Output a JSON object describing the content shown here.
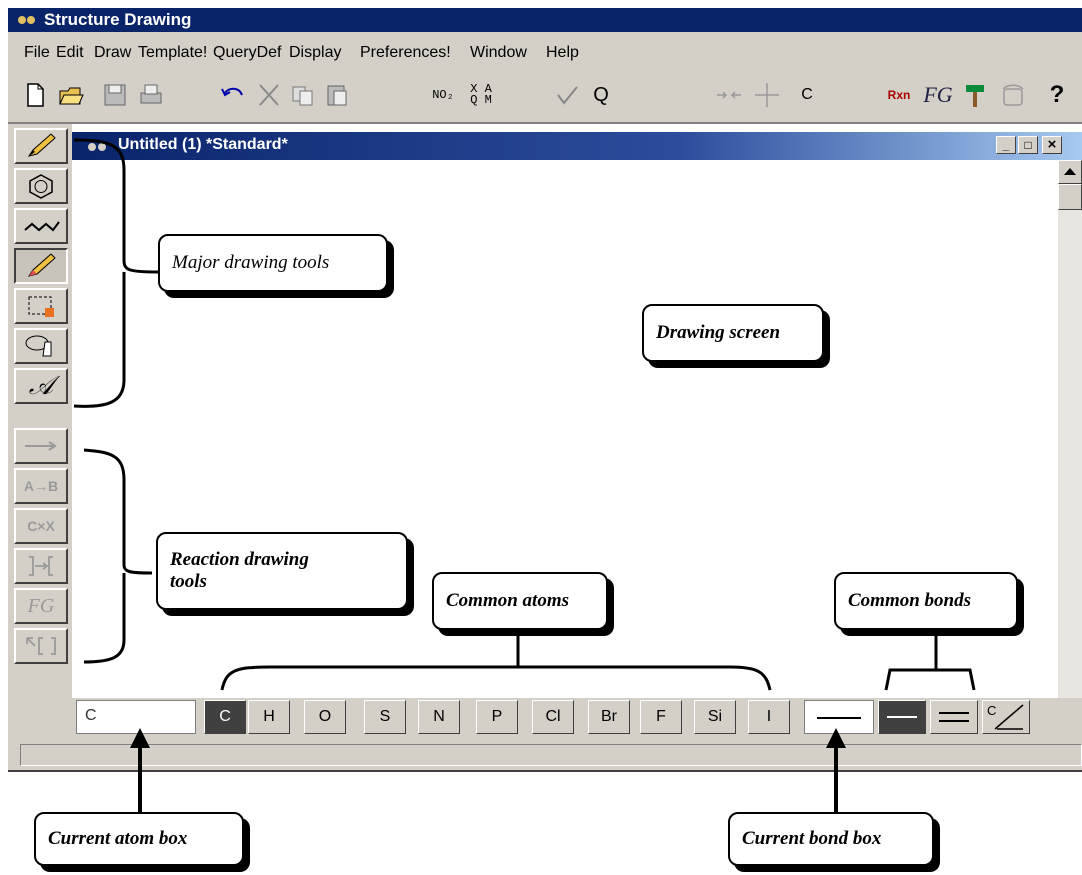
{
  "app": {
    "title": "Structure Drawing",
    "menu": [
      "File",
      "Edit",
      "Draw",
      "Template!",
      "QueryDef",
      "Display",
      "Preferences!",
      "Window",
      "Help"
    ]
  },
  "toolbar": {
    "buttons": [
      {
        "icon": "new-document-icon"
      },
      {
        "icon": "open-folder-icon"
      },
      {
        "icon": "save-icon"
      },
      {
        "icon": "print-icon"
      },
      {
        "icon": "undo-icon"
      },
      {
        "icon": "cut-icon"
      },
      {
        "icon": "copy-icon"
      },
      {
        "icon": "paste-icon"
      },
      {
        "icon": "no2-template-icon",
        "text": "NO₂"
      },
      {
        "icon": "xa-qm-icon",
        "text": "X A Q M"
      },
      {
        "icon": "check-query-icon"
      },
      {
        "icon": "search-icon",
        "text": "Q"
      },
      {
        "icon": "pivot-arrows-icon"
      },
      {
        "icon": "center-icon"
      },
      {
        "icon": "carbon-atom-tool-icon",
        "text": "C"
      },
      {
        "icon": "rxn-icon",
        "text": "Rxn"
      },
      {
        "icon": "fg-icon",
        "text": "FG"
      },
      {
        "icon": "hammer-icon"
      },
      {
        "icon": "phone-icon"
      },
      {
        "icon": "help-icon",
        "text": "?"
      }
    ]
  },
  "document": {
    "title": "Untitled (1) *Standard*",
    "min_label": "_",
    "max_label": "□",
    "close_label": "×"
  },
  "palette": [
    {
      "icon": "pencil-icon"
    },
    {
      "icon": "ring-template-icon"
    },
    {
      "icon": "chain-icon"
    },
    {
      "icon": "eraser-pencil-icon",
      "pressed": true
    },
    {
      "icon": "select-box-icon"
    },
    {
      "icon": "lasso-hand-icon"
    },
    {
      "icon": "text-tool-icon"
    },
    {
      "icon": "reaction-arrow-icon"
    },
    {
      "icon": "a-to-b-icon",
      "text": "A→B"
    },
    {
      "icon": "c-x-icon",
      "text": "C×X"
    },
    {
      "icon": "atom-map-icon"
    },
    {
      "icon": "fg-palette-icon",
      "text": "FG"
    },
    {
      "icon": "select-bracket-icon"
    }
  ],
  "atom_box_value": "C",
  "atoms": [
    "C",
    "H",
    "O",
    "S",
    "N",
    "P",
    "Cl",
    "Br",
    "F",
    "Si",
    "I"
  ],
  "bonds": [
    {
      "name": "single"
    },
    {
      "name": "single-selected"
    },
    {
      "name": "double"
    },
    {
      "name": "c-special"
    }
  ],
  "bond_c_label": "C",
  "callouts": {
    "major_tools": "Major drawing tools",
    "drawing_screen": "Drawing screen",
    "reaction_tools_line1": "Reaction drawing",
    "reaction_tools_line2": "tools",
    "common_atoms": "Common atoms",
    "common_bonds": "Common bonds",
    "current_atom": "Current atom box",
    "current_bond": "Current bond box"
  }
}
